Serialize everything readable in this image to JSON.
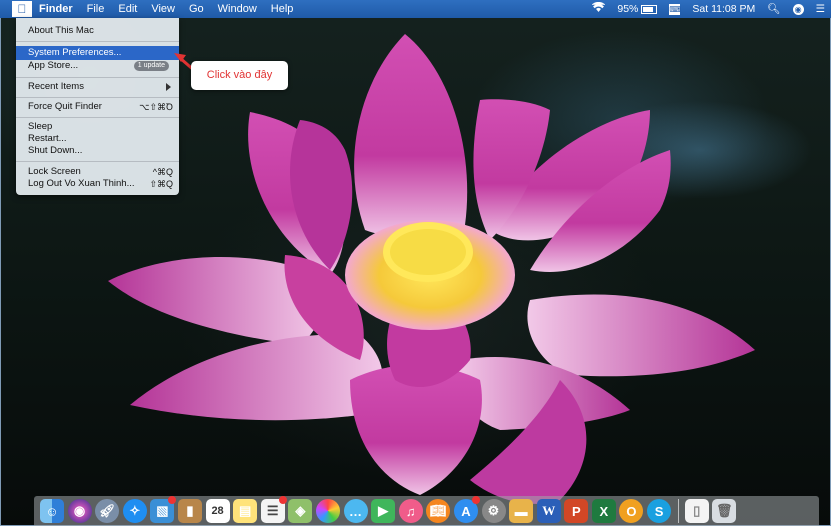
{
  "menubar": {
    "apple_icon": "apple-icon",
    "app_name": "Finder",
    "menus": [
      "File",
      "Edit",
      "View",
      "Go",
      "Window",
      "Help"
    ],
    "battery": "95%",
    "clock": "Sat 11:08 PM"
  },
  "apple_menu": {
    "about": "About This Mac",
    "system_preferences": "System Preferences...",
    "app_store": "App Store...",
    "app_store_badge": "1 update",
    "recent_items": "Recent Items",
    "force_quit": "Force Quit Finder",
    "force_quit_shortcut": "⌥⇧⌘Ꝺ",
    "sleep": "Sleep",
    "restart": "Restart...",
    "shut_down": "Shut Down...",
    "lock_screen": "Lock Screen",
    "lock_screen_shortcut": "^⌘Q",
    "log_out": "Log Out Vo Xuan Thinh...",
    "log_out_shortcut": "⇧⌘Q"
  },
  "callout": {
    "text": "Click vào đây"
  },
  "dock": {
    "calendar_day": "28",
    "word_letter": "W",
    "powerpoint_letter": "P",
    "excel_letter": "X",
    "outlook_letter": "O",
    "skype_letter": "S"
  },
  "colors": {
    "menubar": "#1f5aa8",
    "selection": "#2b67c8",
    "callout_text": "#e13333",
    "lotus_petal": "#c23aa0"
  }
}
